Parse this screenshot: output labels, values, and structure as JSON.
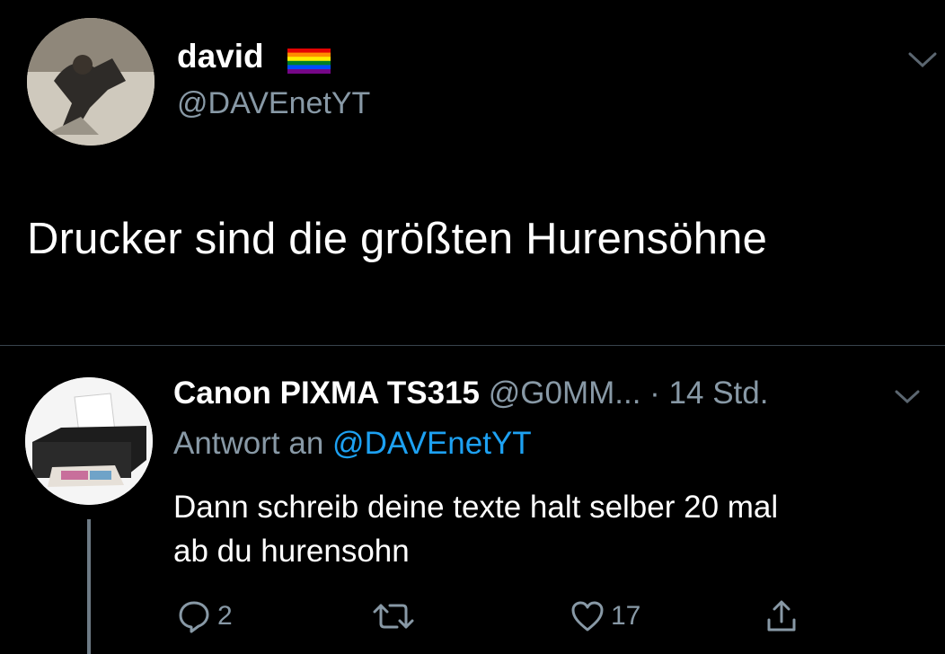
{
  "tweet": {
    "author_name": "david",
    "author_handle": "@DAVEnetYT",
    "text": "Drucker sind die größten Hurensöhne",
    "menu_icon": "chevron-down-icon",
    "badge_icon": "rainbow-flag-icon"
  },
  "reply": {
    "author_name": "Canon PIXMA TS315",
    "author_handle": "@G0MM...",
    "time": "· 14 Std.",
    "replying_to_prefix": "Antwort an",
    "replying_to_handle": "@DAVEnetYT",
    "text_line1": "Dann schreib deine texte halt selber 20 mal",
    "text_line2": "ab du hurensohn",
    "actions": {
      "reply_count": "2",
      "retweet_count": "",
      "like_count": "17",
      "share_count": ""
    }
  },
  "colors": {
    "background": "#000000",
    "secondary_text": "#8899a6",
    "mention": "#1da1f2",
    "divider": "#38444d"
  }
}
